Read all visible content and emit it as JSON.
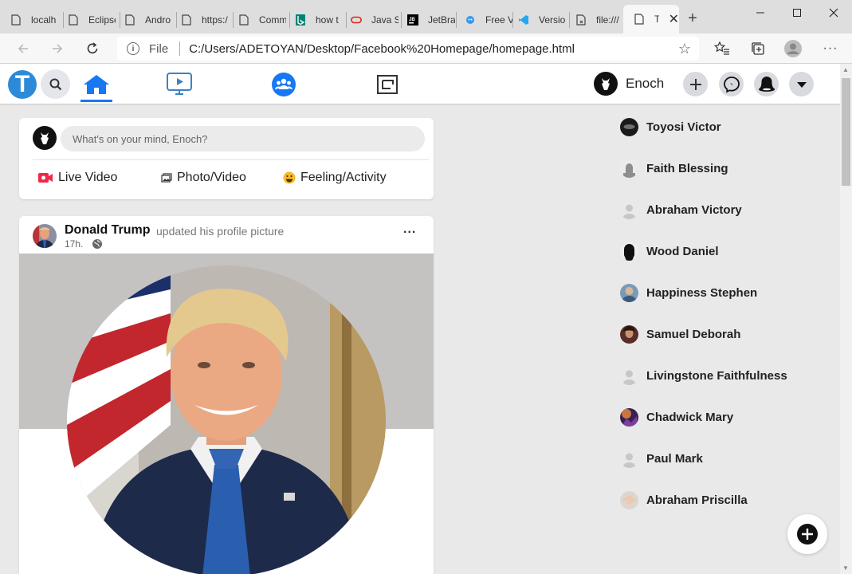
{
  "browser": {
    "tabs": [
      {
        "title": "localh",
        "icon": "page-icon"
      },
      {
        "title": "Eclipse",
        "icon": "page-icon"
      },
      {
        "title": "Andro",
        "icon": "page-icon"
      },
      {
        "title": "https:/",
        "icon": "page-icon"
      },
      {
        "title": "Comm",
        "icon": "page-icon"
      },
      {
        "title": "how t",
        "icon": "bing-icon"
      },
      {
        "title": "Java S",
        "icon": "oracle-icon"
      },
      {
        "title": "JetBra",
        "icon": "jetbrains-icon"
      },
      {
        "title": "Free V",
        "icon": "fontawesome-icon"
      },
      {
        "title": "Versio",
        "icon": "vscode-icon"
      },
      {
        "title": "file:///",
        "icon": "file-icon"
      },
      {
        "title": "To",
        "icon": "page-icon",
        "active": true
      }
    ],
    "address": {
      "scheme_label": "File",
      "url": "C:/Users/ADETOYAN/Desktop/Facebook%20Homepage/homepage.html"
    }
  },
  "header": {
    "logo_letter": "T",
    "user_name": "Enoch",
    "nav": [
      "home-icon",
      "watch-icon",
      "groups-icon",
      "gaming-icon"
    ],
    "accent": "#1877f2"
  },
  "composer": {
    "placeholder": "What's on your mind, Enoch?",
    "actions": [
      {
        "label": "Live Video",
        "icon": "live-video-icon"
      },
      {
        "label": "Photo/Video",
        "icon": "photo-icon"
      },
      {
        "label": "Feeling/Activity",
        "icon": "smiley-icon"
      }
    ]
  },
  "post": {
    "author": "Donald Trump",
    "action": "updated his profile picture",
    "time": "17h.",
    "more": "..."
  },
  "contacts": [
    "Toyosi Victor",
    "Faith Blessing",
    "Abraham Victory",
    "Wood Daniel",
    "Happiness Stephen",
    "Samuel Deborah",
    "Livingstone Faithfulness",
    "Chadwick Mary",
    "Paul Mark",
    "Abraham Priscilla"
  ]
}
